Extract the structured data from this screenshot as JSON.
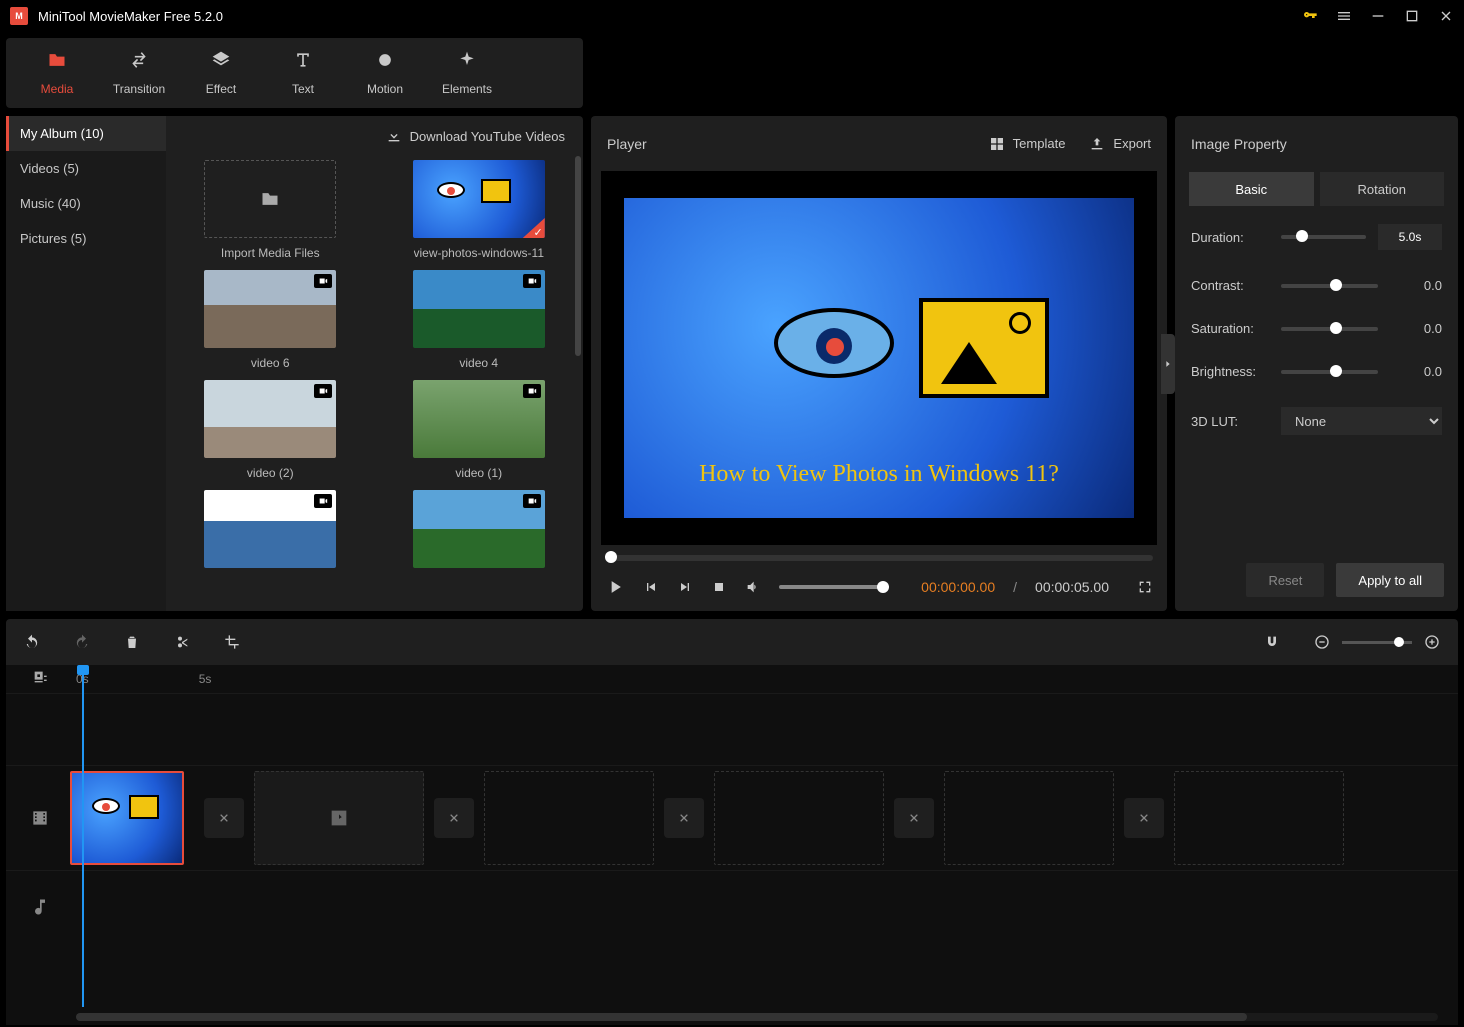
{
  "app": {
    "title": "MiniTool MovieMaker Free 5.2.0"
  },
  "topTabs": [
    {
      "label": "Media",
      "icon": "folder",
      "active": true
    },
    {
      "label": "Transition",
      "icon": "swap"
    },
    {
      "label": "Effect",
      "icon": "layers"
    },
    {
      "label": "Text",
      "icon": "text"
    },
    {
      "label": "Motion",
      "icon": "circle"
    },
    {
      "label": "Elements",
      "icon": "sparkle"
    }
  ],
  "media": {
    "download": "Download YouTube Videos",
    "categories": [
      {
        "label": "My Album (10)",
        "active": true
      },
      {
        "label": "Videos (5)"
      },
      {
        "label": "Music (40)"
      },
      {
        "label": "Pictures (5)"
      }
    ],
    "items": [
      {
        "label": "Import Media Files",
        "type": "import"
      },
      {
        "label": "view-photos-windows-11",
        "type": "image",
        "selected": true,
        "preview": "win11"
      },
      {
        "label": "video 6",
        "type": "video",
        "preview": "london"
      },
      {
        "label": "video 4",
        "type": "video",
        "preview": "coast"
      },
      {
        "label": "video (2)",
        "type": "video",
        "preview": "balloons"
      },
      {
        "label": "video (1)",
        "type": "video",
        "preview": "person"
      },
      {
        "label": "",
        "type": "video",
        "preview": "couple"
      },
      {
        "label": "",
        "type": "video",
        "preview": "mountain"
      }
    ]
  },
  "player": {
    "title": "Player",
    "template": "Template",
    "export": "Export",
    "caption": "How to View Photos in Windows 11?",
    "current": "00:00:00.00",
    "separator": "/",
    "duration": "00:00:05.00"
  },
  "props": {
    "title": "Image Property",
    "tabs": [
      {
        "label": "Basic",
        "active": true
      },
      {
        "label": "Rotation"
      }
    ],
    "rows": [
      {
        "label": "Duration:",
        "value": "5.0s",
        "box": true,
        "pos": 18
      },
      {
        "label": "Contrast:",
        "value": "0.0",
        "pos": 50
      },
      {
        "label": "Saturation:",
        "value": "0.0",
        "pos": 50
      },
      {
        "label": "Brightness:",
        "value": "0.0",
        "pos": 50
      }
    ],
    "lut": {
      "label": "3D LUT:",
      "value": "None"
    },
    "reset": "Reset",
    "apply": "Apply to all"
  },
  "ruler": [
    "0s",
    "5s"
  ]
}
